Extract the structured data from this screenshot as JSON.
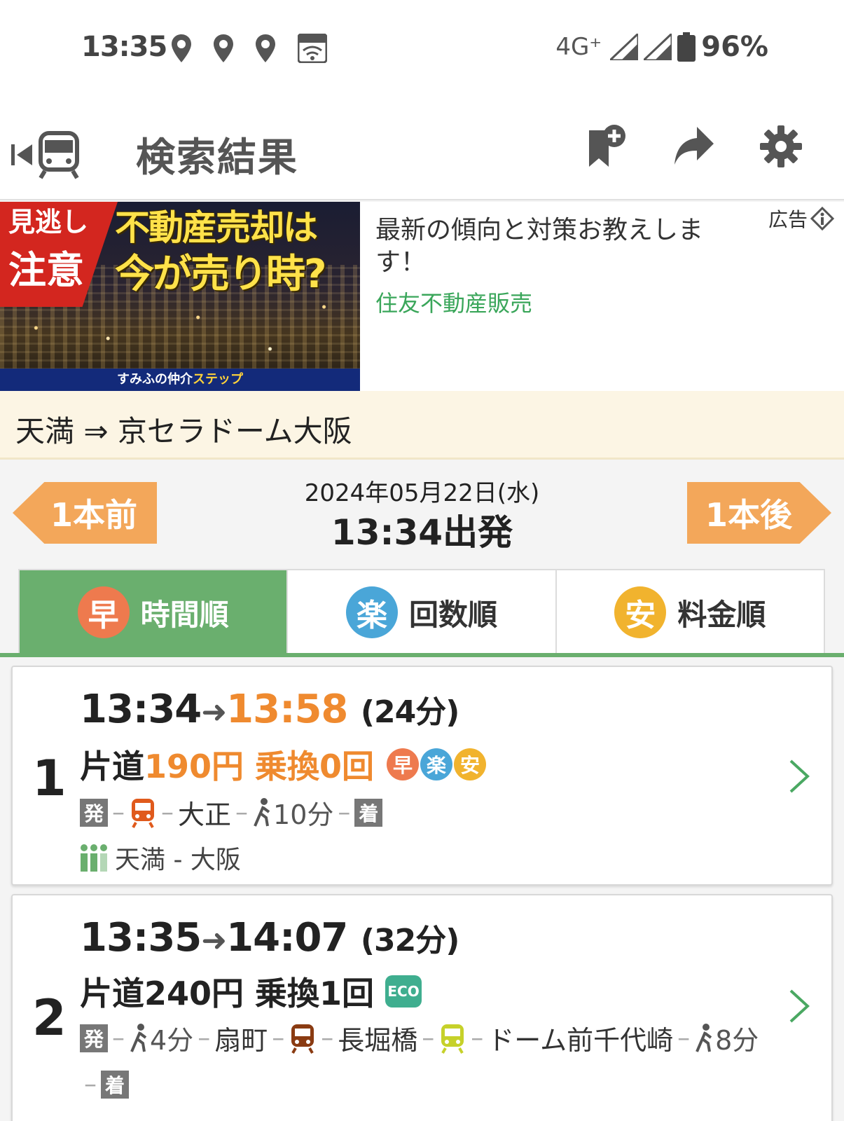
{
  "status_bar": {
    "time": "13:35",
    "network": "4G⁺",
    "battery": "96%"
  },
  "app_bar": {
    "title": "検索結果"
  },
  "ad": {
    "image_line_miss": "見逃し",
    "image_line_caution": "注意",
    "image_headline1": "不動産売却は",
    "image_headline2": "今が売り時?",
    "image_footer_a": "すみふの仲介",
    "image_footer_b": "ステップ",
    "text": "最新の傾向と対策お教えします！",
    "sponsor": "住友不動産販売",
    "label": "広告"
  },
  "route": {
    "text": "天満 ⇒ 京セラドーム大阪"
  },
  "date_nav": {
    "prev_label": "1本前",
    "next_label": "1本後",
    "date": "2024年05月22日(水)",
    "depart": "13:34出発"
  },
  "tabs": [
    {
      "badge": "早",
      "label": "時間順",
      "color": "#ee7a4e"
    },
    {
      "badge": "楽",
      "label": "回数順",
      "color": "#4aa6d8"
    },
    {
      "badge": "安",
      "label": "料金順",
      "color": "#f1b32e"
    }
  ],
  "results": [
    {
      "rank": "1",
      "depart": "13:34",
      "arrive": "13:58",
      "duration": "(24分)",
      "fare_prefix": "片道",
      "fare": "190円",
      "transfers": "乗換0回",
      "badges": [
        "早",
        "楽",
        "安"
      ],
      "dep_label": "発",
      "station1": "大正",
      "walk1": "10分",
      "arr_label": "着",
      "line_info": "天満 - 大阪"
    },
    {
      "rank": "2",
      "depart": "13:35",
      "arrive": "14:07",
      "duration": "(32分)",
      "fare_prefix": "片道",
      "fare": "240円",
      "transfers": "乗換1回",
      "eco_label": "ECO",
      "dep_label": "発",
      "walk1": "4分",
      "station1": "扇町",
      "station2": "長堀橋",
      "station3": "ドーム前千代崎",
      "walk2": "8分",
      "arr_label": "着"
    }
  ],
  "colors": {
    "accent_green": "#6aaf6e",
    "orange": "#ef8a2f",
    "nav_orange": "#f3a75a",
    "sponsor_green": "#3aa65a"
  }
}
